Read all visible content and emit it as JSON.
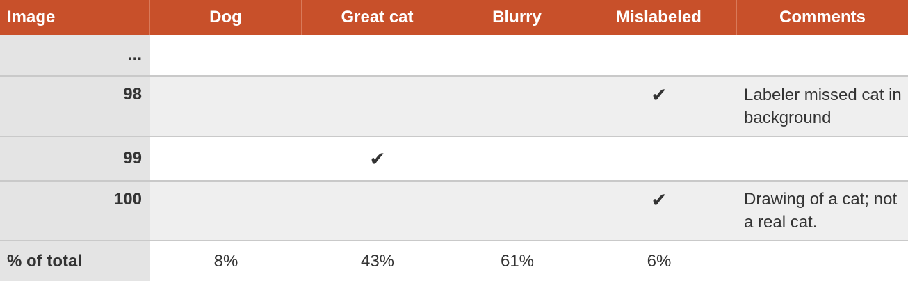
{
  "header": {
    "image": "Image",
    "dog": "Dog",
    "great_cat": "Great cat",
    "blurry": "Blurry",
    "mislabeled": "Mislabeled",
    "comments": "Comments"
  },
  "rows": [
    {
      "image": "...",
      "dog": "",
      "great_cat": "",
      "blurry": "",
      "mislabeled": "",
      "comments": ""
    },
    {
      "image": "98",
      "dog": "",
      "great_cat": "",
      "blurry": "",
      "mislabeled": "✔",
      "comments": "Labeler missed cat in background"
    },
    {
      "image": "99",
      "dog": "",
      "great_cat": "✔",
      "blurry": "",
      "mislabeled": "",
      "comments": ""
    },
    {
      "image": "100",
      "dog": "",
      "great_cat": "",
      "blurry": "",
      "mislabeled": "✔",
      "comments": "Drawing of a cat; not a real cat."
    }
  ],
  "totals": {
    "label": "% of total",
    "dog": "8%",
    "great_cat": "43%",
    "blurry": "61%",
    "mislabeled": "6%",
    "comments": ""
  },
  "colors": {
    "header_bg": "#c8502a",
    "header_text": "#ffffff",
    "index_col_bg": "#e4e4e4",
    "alt_row_bg": "#efefef"
  }
}
